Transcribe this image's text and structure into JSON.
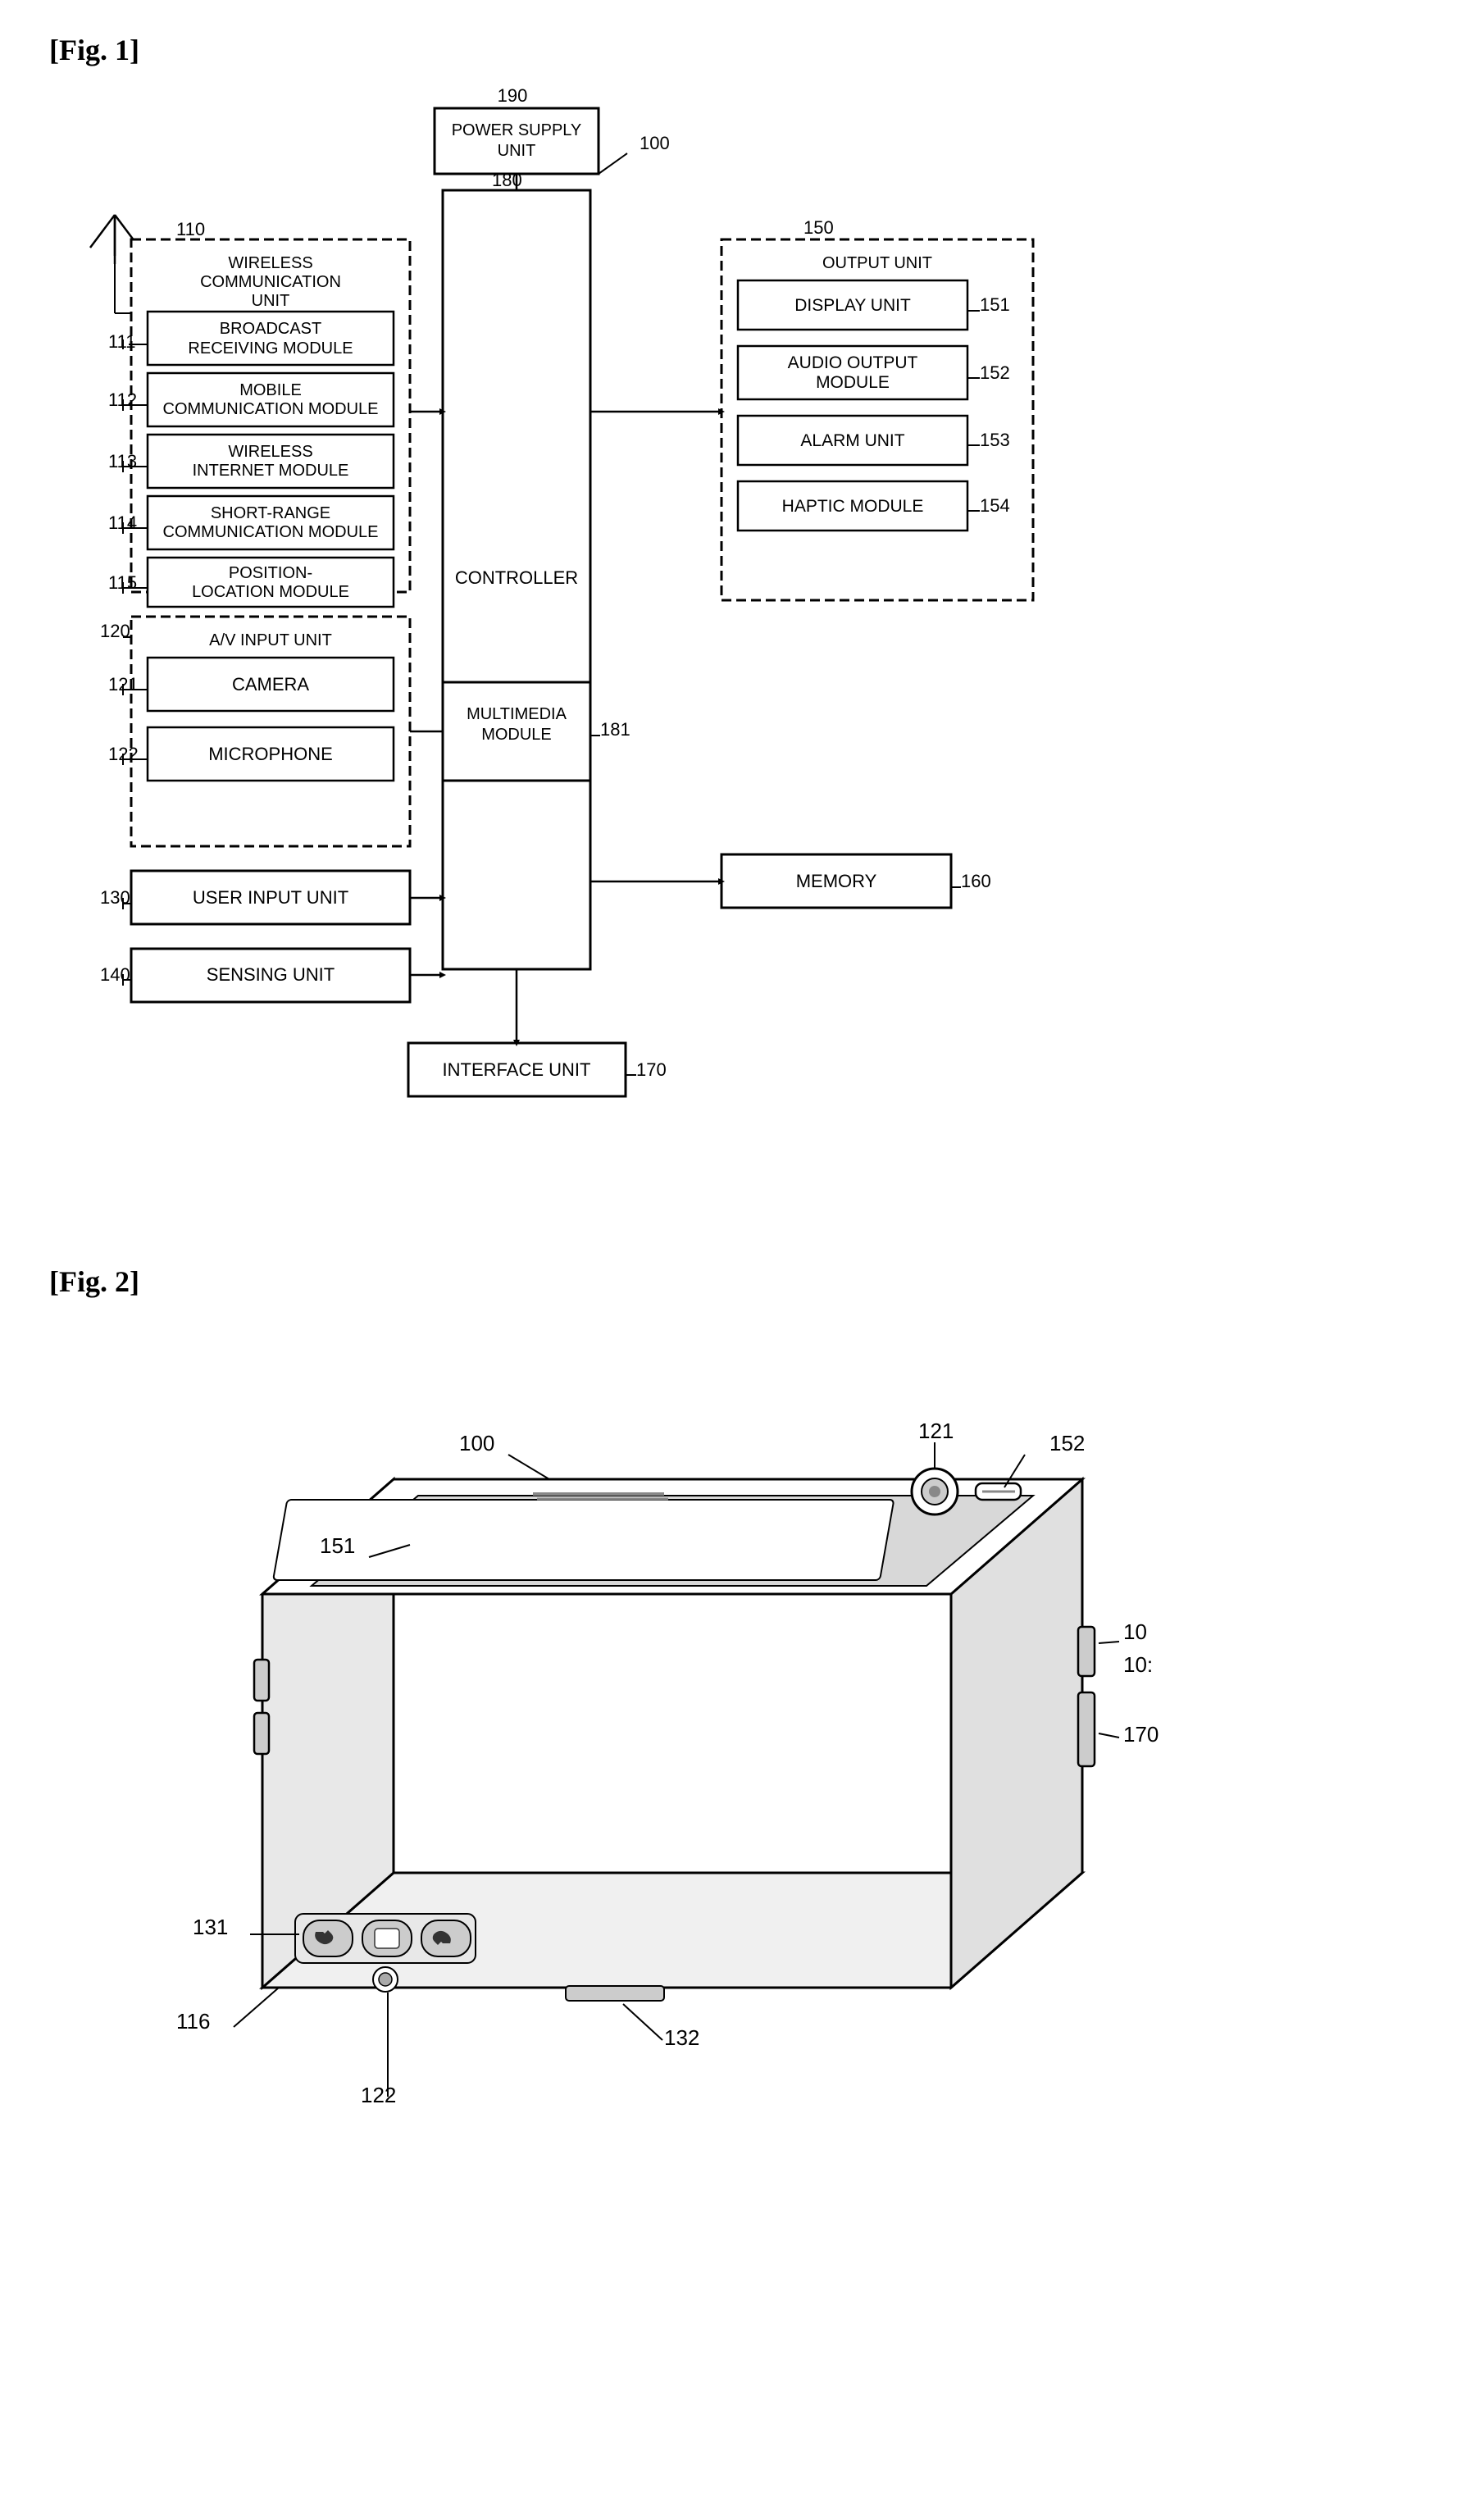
{
  "fig1": {
    "label": "[Fig. 1]",
    "boxes": {
      "power_supply": {
        "text": "POWER SUPPLY\nUNIT",
        "num": "190"
      },
      "main_100": {
        "num": "100"
      },
      "controller": {
        "text": "CONTROLLER"
      },
      "wireless_comm": {
        "text": "WIRELESS\nCOMMUNICATION\nUNIT",
        "num": "110"
      },
      "broadcast": {
        "text": "BROADCAST\nRECEIVING\nMODULE",
        "num": "111"
      },
      "mobile_comm": {
        "text": "MOBILE\nCOMMUNICATION\nMODULE",
        "num": "112"
      },
      "wireless_internet": {
        "text": "WIRELESS\nINTERNET MODULE",
        "num": "113"
      },
      "short_range": {
        "text": "SHORT-RANGE\nCOMMUNICATION\nMODULE",
        "num": "114"
      },
      "position": {
        "text": "POSITION-\nLOCATION MODULE",
        "num": "115"
      },
      "av_input": {
        "text": "A/V INPUT UNIT",
        "num": "120"
      },
      "camera": {
        "text": "CAMERA",
        "num": "121"
      },
      "microphone": {
        "text": "MICROPHONE",
        "num": "122"
      },
      "user_input": {
        "text": "USER INPUT UNIT",
        "num": "130"
      },
      "sensing": {
        "text": "SENSING UNIT",
        "num": "140"
      },
      "output_unit": {
        "text": "OUTPUT UNIT",
        "num": "150"
      },
      "display": {
        "text": "DISPLAY UNIT",
        "num": "151"
      },
      "audio_output": {
        "text": "AUDIO OUTPUT\nMODULE",
        "num": "152"
      },
      "alarm": {
        "text": "ALARM UNIT",
        "num": "153"
      },
      "haptic": {
        "text": "HAPTIC MODULE",
        "num": "154"
      },
      "multimedia": {
        "text": "MULTIMEDIA\nMODULE",
        "num": "181"
      },
      "memory": {
        "text": "MEMORY",
        "num": "160"
      },
      "interface": {
        "text": "INTERFACE UNIT",
        "num": "170"
      },
      "main_block": {
        "num": "180"
      }
    }
  },
  "fig2": {
    "label": "[Fig. 2]",
    "labels": {
      "100": "100",
      "10": "10",
      "101": "10:",
      "116": "116",
      "121": "121",
      "122": "122",
      "131": "131",
      "132": "132",
      "151": "151",
      "152": "152",
      "170": "170"
    }
  }
}
